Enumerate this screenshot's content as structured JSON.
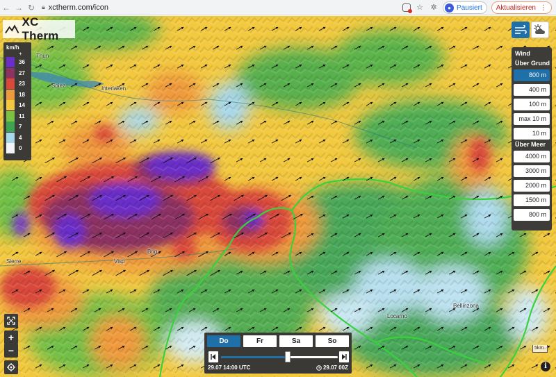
{
  "browser": {
    "url": "xctherm.com/icon",
    "paused_label": "Pausiert",
    "update_label": "Aktualisieren"
  },
  "app": {
    "logo_text": "XC Therm"
  },
  "legend": {
    "title": "km/h",
    "plus": "+",
    "items": [
      {
        "label": "36",
        "color": "#6a2fc9"
      },
      {
        "label": "27",
        "color": "#8c3362"
      },
      {
        "label": "23",
        "color": "#d9493a"
      },
      {
        "label": "18",
        "color": "#f09a3e"
      },
      {
        "label": "14",
        "color": "#f3c93f"
      },
      {
        "label": "11",
        "color": "#7cc242"
      },
      {
        "label": "7",
        "color": "#3da452"
      },
      {
        "label": "4",
        "color": "#a8d8ec"
      },
      {
        "label": "0",
        "color": "#f2f4f7"
      }
    ]
  },
  "places": [
    {
      "name": "Thun"
    },
    {
      "name": "Spiez"
    },
    {
      "name": "Interlaken"
    },
    {
      "name": "Sierre"
    },
    {
      "name": "Visp"
    },
    {
      "name": "Brig"
    },
    {
      "name": "Locarno"
    },
    {
      "name": "Bellinzona"
    }
  ],
  "wind_panel": {
    "title": "Wind",
    "above_ground": "Über Grund",
    "above_sea": "Über Meer",
    "ground_levels": [
      {
        "label": "800 m",
        "active": true
      },
      {
        "label": "400 m",
        "active": false
      },
      {
        "label": "100 m",
        "active": false
      },
      {
        "label": "max 10 m",
        "active": false
      },
      {
        "label": "10 m",
        "active": false
      }
    ],
    "sea_levels": [
      {
        "label": "4000 m"
      },
      {
        "label": "3000 m"
      },
      {
        "label": "2000 m"
      },
      {
        "label": "1500 m"
      },
      {
        "label": "800 m"
      }
    ]
  },
  "time_panel": {
    "days": [
      {
        "label": "Do",
        "active": true
      },
      {
        "label": "Fr",
        "active": false
      },
      {
        "label": "Sa",
        "active": false
      },
      {
        "label": "So",
        "active": false
      }
    ],
    "slider_position": 0.57,
    "current_time": "29.07 14:00 UTC",
    "model_time": "29.07 00Z"
  },
  "scale_label": "5km",
  "colors": {
    "accent": "#1f6fa8",
    "panel": "#3b3a36",
    "border_line": "#39d23c"
  }
}
